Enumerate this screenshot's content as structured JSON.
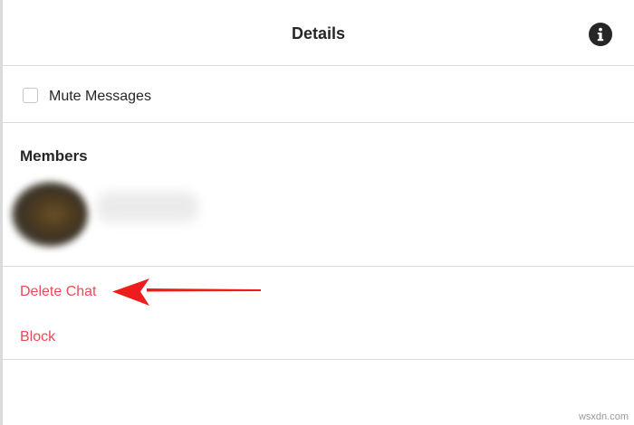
{
  "header": {
    "title": "Details",
    "info_icon": "info-circle-icon"
  },
  "options": {
    "mute_label": "Mute Messages",
    "mute_checked": false
  },
  "members": {
    "heading": "Members",
    "items": [
      {
        "avatar": "avatar-blurred",
        "name_blurred": true
      }
    ]
  },
  "actions": {
    "delete_label": "Delete Chat",
    "block_label": "Block",
    "color": "#ed4956"
  },
  "annotation": {
    "arrow_color": "#ee1c1c",
    "points_to": "Delete Chat"
  },
  "watermark": "wsxdn.com"
}
